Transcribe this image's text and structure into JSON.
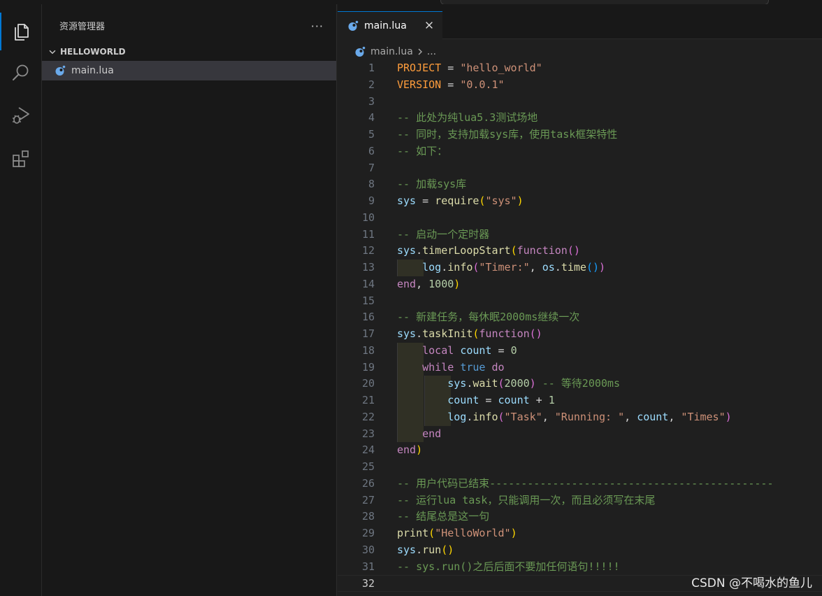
{
  "sidebar": {
    "title": "资源管理器",
    "more": "···",
    "folder": "HELLOWORLD",
    "file": "main.lua"
  },
  "editor": {
    "tab_label": "main.lua",
    "breadcrumb_file": "main.lua",
    "breadcrumb_more": "..."
  },
  "code_lines": [
    [
      [
        "cst",
        "PROJECT"
      ],
      [
        "op",
        " = "
      ],
      [
        "str",
        "\"hello_world\""
      ]
    ],
    [
      [
        "cst",
        "VERSION"
      ],
      [
        "op",
        " = "
      ],
      [
        "str",
        "\"0.0.1\""
      ]
    ],
    [],
    [
      [
        "cmt",
        "-- 此处为纯lua5.3测试场地"
      ]
    ],
    [
      [
        "cmt",
        "-- 同时，支持加载sys库，使用task框架特性"
      ]
    ],
    [
      [
        "cmt",
        "-- 如下："
      ]
    ],
    [],
    [
      [
        "cmt",
        "-- 加载sys库"
      ]
    ],
    [
      [
        "var",
        "sys"
      ],
      [
        "op",
        " = "
      ],
      [
        "fn",
        "require"
      ],
      [
        "p1",
        "("
      ],
      [
        "str",
        "\"sys\""
      ],
      [
        "p1",
        ")"
      ]
    ],
    [],
    [
      [
        "cmt",
        "-- 启动一个定时器"
      ]
    ],
    [
      [
        "var",
        "sys"
      ],
      [
        "op",
        "."
      ],
      [
        "fn",
        "timerLoopStart"
      ],
      [
        "p1",
        "("
      ],
      [
        "kw",
        "function"
      ],
      [
        "p2",
        "()"
      ]
    ],
    [
      [
        "guide1",
        ""
      ],
      [
        "txt4",
        "    "
      ],
      [
        "var",
        "log"
      ],
      [
        "op",
        "."
      ],
      [
        "fn",
        "info"
      ],
      [
        "p2",
        "("
      ],
      [
        "str",
        "\"Timer:\""
      ],
      [
        "op",
        ", "
      ],
      [
        "var",
        "os"
      ],
      [
        "op",
        "."
      ],
      [
        "fn",
        "time"
      ],
      [
        "p3",
        "()"
      ],
      [
        "p2",
        ")"
      ]
    ],
    [
      [
        "kw",
        "end"
      ],
      [
        "op",
        ", "
      ],
      [
        "num",
        "1000"
      ],
      [
        "p1",
        ")"
      ]
    ],
    [],
    [
      [
        "cmt",
        "-- 新建任务，每休眠2000ms继续一次"
      ]
    ],
    [
      [
        "var",
        "sys"
      ],
      [
        "op",
        "."
      ],
      [
        "fn",
        "taskInit"
      ],
      [
        "p1",
        "("
      ],
      [
        "kw",
        "function"
      ],
      [
        "p2",
        "()"
      ]
    ],
    [
      [
        "guide1",
        ""
      ],
      [
        "txt4",
        "    "
      ],
      [
        "kw",
        "local"
      ],
      [
        "op",
        " "
      ],
      [
        "var",
        "count"
      ],
      [
        "op",
        " = "
      ],
      [
        "num",
        "0"
      ]
    ],
    [
      [
        "guide1",
        ""
      ],
      [
        "txt4",
        "    "
      ],
      [
        "kw",
        "while"
      ],
      [
        "op",
        " "
      ],
      [
        "kwb",
        "true"
      ],
      [
        "op",
        " "
      ],
      [
        "kw",
        "do"
      ]
    ],
    [
      [
        "guide1",
        ""
      ],
      [
        "guide2",
        ""
      ],
      [
        "txt4",
        "        "
      ],
      [
        "var",
        "sys"
      ],
      [
        "op",
        "."
      ],
      [
        "fn",
        "wait"
      ],
      [
        "p2",
        "("
      ],
      [
        "num",
        "2000"
      ],
      [
        "p2",
        ")"
      ],
      [
        "op",
        " "
      ],
      [
        "cmt",
        "-- 等待2000ms"
      ]
    ],
    [
      [
        "guide1",
        ""
      ],
      [
        "guide2",
        ""
      ],
      [
        "txt4",
        "        "
      ],
      [
        "var",
        "count"
      ],
      [
        "op",
        " = "
      ],
      [
        "var",
        "count"
      ],
      [
        "op",
        " + "
      ],
      [
        "num",
        "1"
      ]
    ],
    [
      [
        "guide1",
        ""
      ],
      [
        "guide2",
        ""
      ],
      [
        "txt4",
        "        "
      ],
      [
        "var",
        "log"
      ],
      [
        "op",
        "."
      ],
      [
        "fn",
        "info"
      ],
      [
        "p2",
        "("
      ],
      [
        "str",
        "\"Task\""
      ],
      [
        "op",
        ", "
      ],
      [
        "str",
        "\"Running: \""
      ],
      [
        "op",
        ", "
      ],
      [
        "var",
        "count"
      ],
      [
        "op",
        ", "
      ],
      [
        "str",
        "\"Times\""
      ],
      [
        "p2",
        ")"
      ]
    ],
    [
      [
        "guide1",
        ""
      ],
      [
        "txt4",
        "    "
      ],
      [
        "kw",
        "end"
      ]
    ],
    [
      [
        "kw",
        "end"
      ],
      [
        "p1",
        ")"
      ]
    ],
    [],
    [
      [
        "cmt",
        "-- 用户代码已结束---------------------------------------------"
      ]
    ],
    [
      [
        "cmt",
        "-- 运行lua task，只能调用一次，而且必须写在末尾"
      ]
    ],
    [
      [
        "cmt",
        "-- 结尾总是这一句"
      ]
    ],
    [
      [
        "fn",
        "print"
      ],
      [
        "p1",
        "("
      ],
      [
        "str",
        "\"HelloWorld\""
      ],
      [
        "p1",
        ")"
      ]
    ],
    [
      [
        "var",
        "sys"
      ],
      [
        "op",
        "."
      ],
      [
        "fn",
        "run"
      ],
      [
        "p1",
        "()"
      ]
    ],
    [
      [
        "cmt",
        "-- sys.run()之后后面不要加任何语句!!!!!"
      ]
    ],
    []
  ],
  "current_line": 32,
  "watermark": "CSDN @不喝水的鱼儿",
  "colors": {
    "accent": "#0078d4",
    "comment": "#6a9955",
    "string": "#ce9178",
    "keyword": "#c586c0",
    "function": "#dcdcaa",
    "variable": "#9cdcfe",
    "number": "#b5cea8"
  },
  "icons": [
    "explorer-icon",
    "search-icon",
    "run-debug-icon",
    "extensions-icon",
    "chevron-down-icon",
    "lua-file-icon",
    "close-icon",
    "chevron-right-icon"
  ]
}
